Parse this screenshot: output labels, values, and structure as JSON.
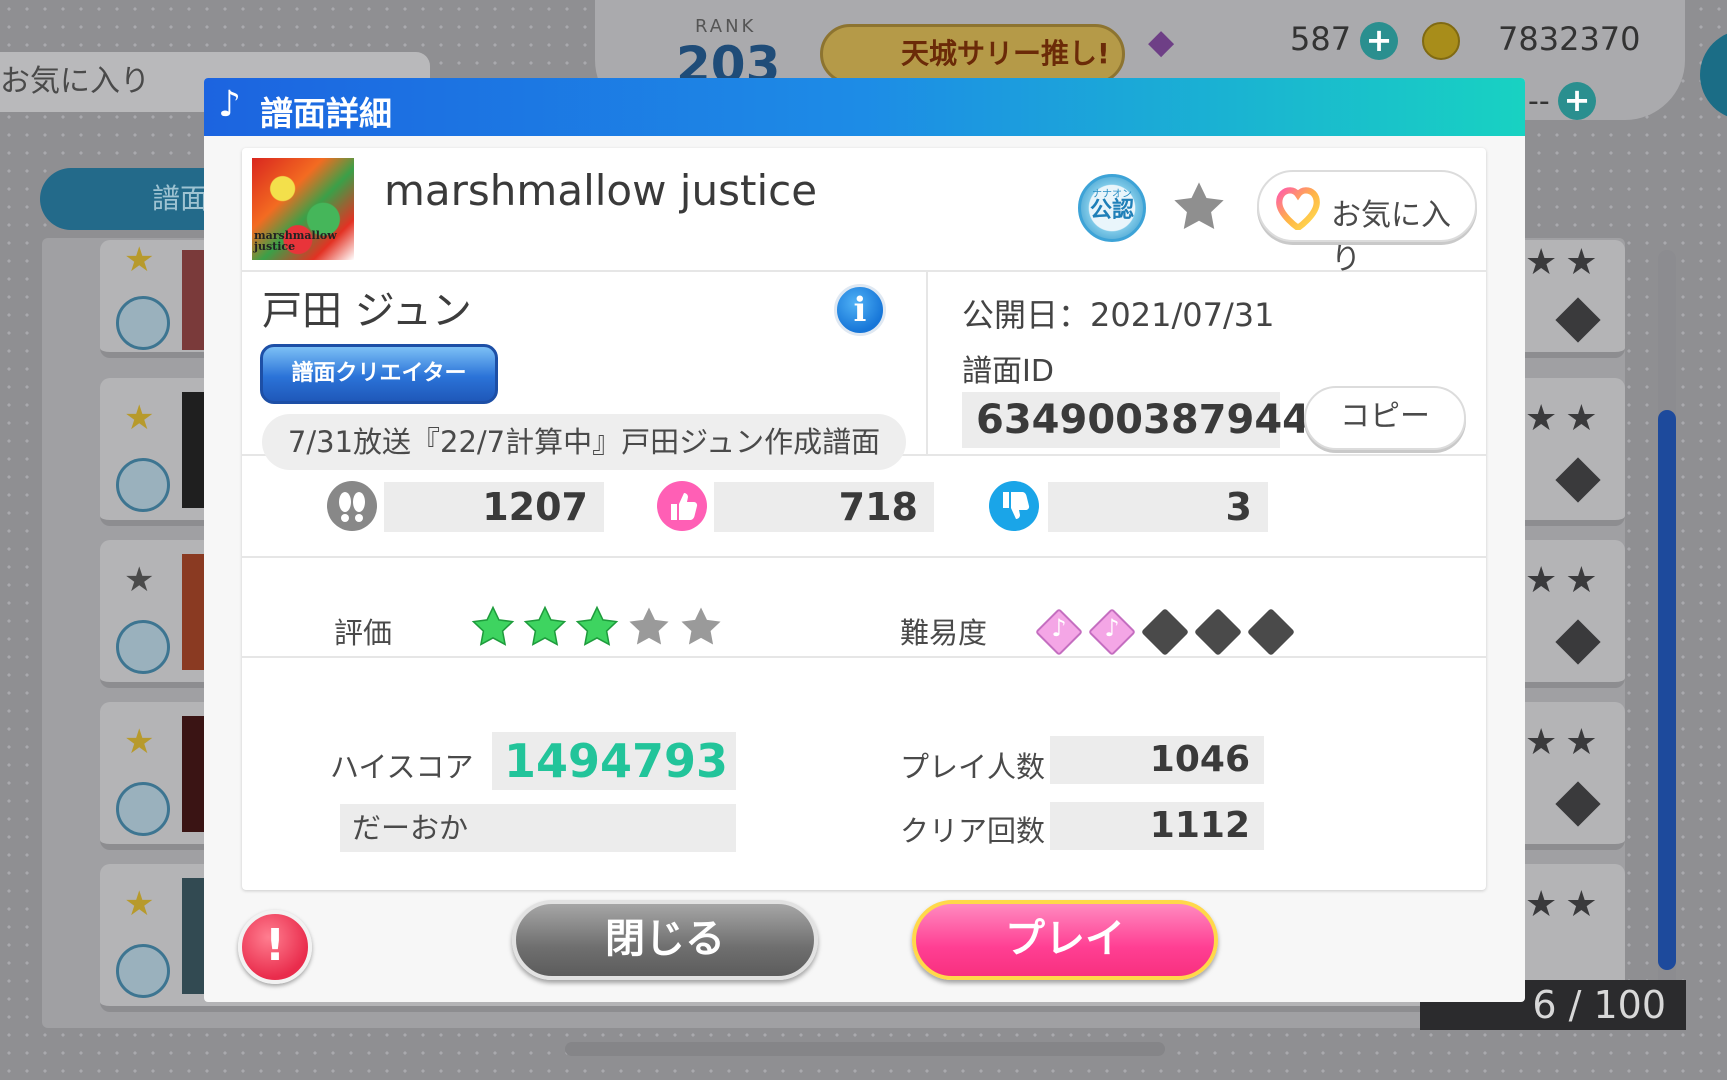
{
  "background": {
    "favorites_tab": "お気に入り",
    "rank_label": "RANK",
    "rank_value": "203",
    "banner_text": "天城サリー推し!",
    "gems": "587",
    "coins": "7832370",
    "stamina": "--",
    "score_tab": "譜面",
    "list_counter": "6 / 100"
  },
  "modal": {
    "title_icon": "♪",
    "title": "譜面詳細",
    "song": {
      "jacket_text": "marshmallow justice",
      "title": "marshmallow justice",
      "official_badge_small": "ナナオン",
      "official_badge": "公認",
      "favorite_label": "お気に入り"
    },
    "creator": {
      "name": "戸田 ジュン",
      "badge": "譜面クリエイター",
      "comment": "7/31放送『22/7計算中』戸田ジュン作成譜面"
    },
    "meta": {
      "publish_date": "公開日：2021/07/31",
      "id_label": "譜面ID",
      "id_value": "634900387944",
      "copy_label": "コピー"
    },
    "stats": {
      "plays_icon": "footprints-icon",
      "plays": "1207",
      "likes": "718",
      "dislikes": "3"
    },
    "rating": {
      "label": "評価",
      "value": 3,
      "max": 5
    },
    "difficulty": {
      "label": "難易度",
      "value": 2,
      "max": 5
    },
    "records": {
      "hiscore_label": "ハイスコア",
      "hiscore": "1494793",
      "hiscore_player": "だーおか",
      "players_label": "プレイ人数",
      "players": "1046",
      "clears_label": "クリア回数",
      "clears": "1112"
    },
    "buttons": {
      "report": "!",
      "close": "閉じる",
      "play": "プレイ"
    }
  },
  "colors": {
    "header_start": "#1c64e0",
    "header_end": "#18d2c2",
    "hiscore": "#22c49a",
    "star_active": "#3ed460",
    "star_inactive": "#9a9a9a",
    "diff_active": "#f4a6e6",
    "diff_inactive": "#4a4a4a",
    "like": "#ff5fb5",
    "dislike": "#1aa5e8",
    "play_button": "#ff3f93"
  }
}
